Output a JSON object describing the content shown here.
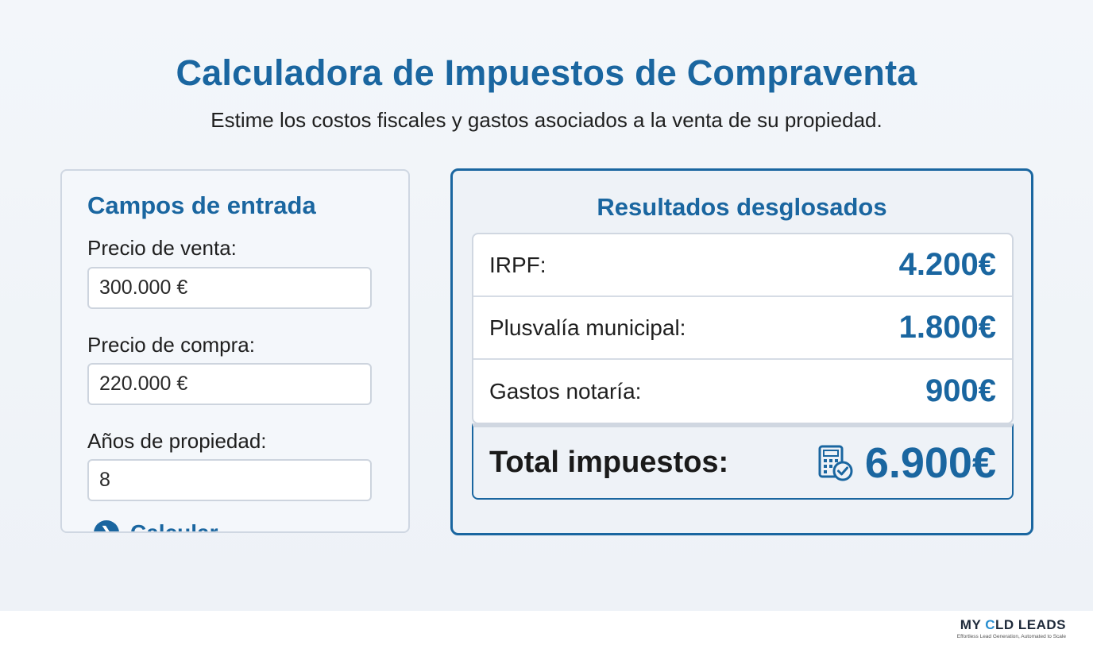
{
  "header": {
    "title": "Calculadora de Impuestos de Compraventa",
    "subtitle": "Estime los costos fiscales y gastos asociados a la venta de su propiedad."
  },
  "inputs": {
    "heading": "Campos de entrada",
    "fields": [
      {
        "label": "Precio de venta:",
        "value": "300.000 €"
      },
      {
        "label": "Precio de compra:",
        "value": "220.000 €"
      },
      {
        "label": "Años de propiedad:",
        "value": "8"
      }
    ],
    "calculate_label": "Calcular"
  },
  "results": {
    "heading": "Resultados desglosados",
    "rows": [
      {
        "label": "IRPF:",
        "value": "4.200€"
      },
      {
        "label": "Plusvalía municipal:",
        "value": "1.800€"
      },
      {
        "label": "Gastos notaría:",
        "value": "900€"
      }
    ],
    "total_label": "Total impuestos:",
    "total_value": "6.900€",
    "total_icon": "calculator-check-icon"
  },
  "footer": {
    "brand_prefix": "MY ",
    "brand_o": "C",
    "brand_suffix": "LD LEADS",
    "tagline": "Effortless Lead Generation, Automated to Scale"
  },
  "colors": {
    "accent": "#1a66a0",
    "background": "#f2f5f9"
  }
}
